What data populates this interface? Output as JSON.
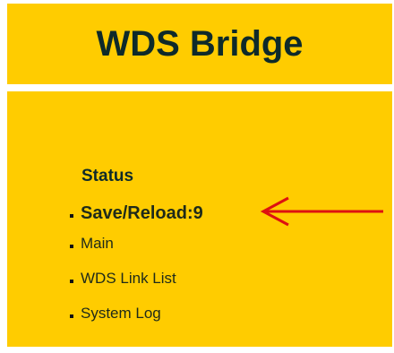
{
  "header": {
    "title": "WDS Bridge"
  },
  "menu": {
    "heading": "Status",
    "items": [
      {
        "label": "Save/Reload:9",
        "emphasized": true
      },
      {
        "label": "Main"
      },
      {
        "label": "WDS Link List"
      },
      {
        "label": "System Log"
      }
    ]
  },
  "annotation": {
    "arrow_color": "#dd1111",
    "icon": "left-arrow-icon"
  },
  "colors": {
    "panel_background": "#FFCC00",
    "text": "#0e2a2a"
  }
}
